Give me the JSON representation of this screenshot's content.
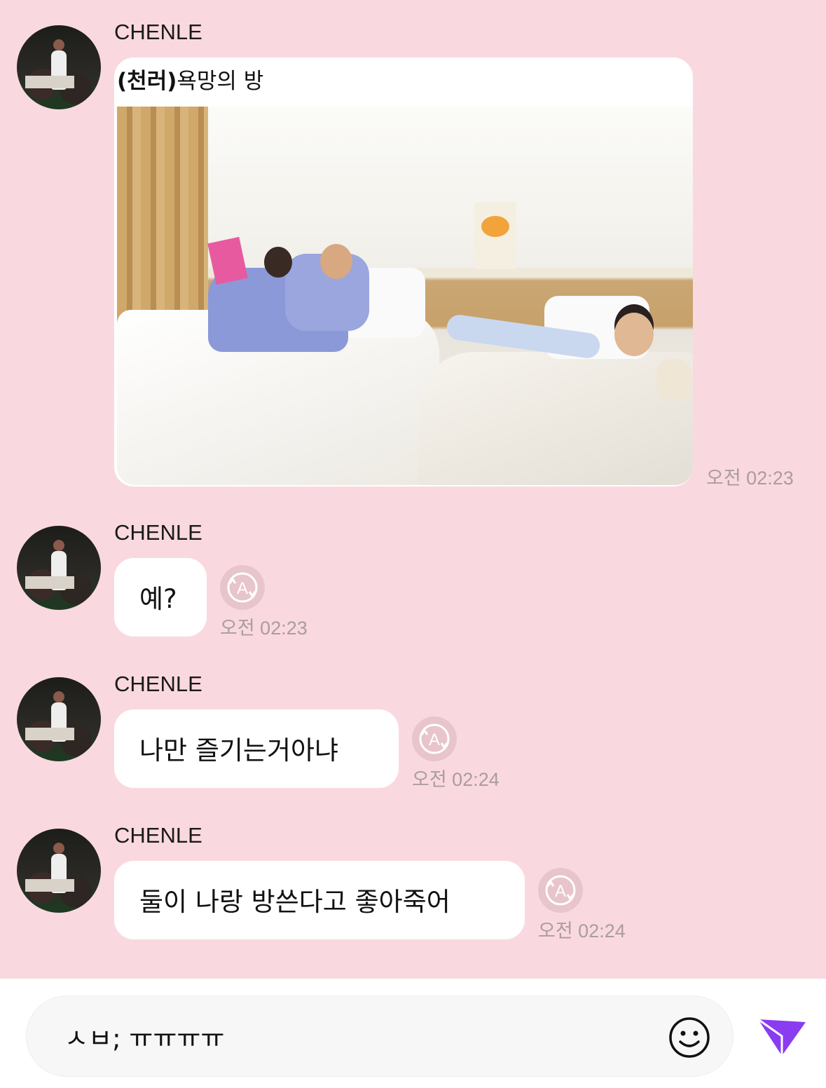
{
  "messages": [
    {
      "sender": "CHENLE",
      "type": "image",
      "caption_bold": "(천러)",
      "caption_rest": "욕망의 방",
      "time": "오전 02:23"
    },
    {
      "sender": "CHENLE",
      "type": "text",
      "text": "예?",
      "time": "오전 02:23"
    },
    {
      "sender": "CHENLE",
      "type": "text",
      "text": "나만 즐기는거아냐",
      "time": "오전 02:24"
    },
    {
      "sender": "CHENLE",
      "type": "text",
      "text": "둘이 나랑 방쓴다고 좋아죽어",
      "time": "오전 02:24"
    }
  ],
  "input": {
    "value": "ㅅㅂ; ㅠㅠㅠㅠ"
  },
  "icons": {
    "translate": "translate-icon",
    "emoji": "smiley-icon",
    "send": "paper-plane-icon"
  },
  "colors": {
    "background": "#f9d9df",
    "bubble": "#ffffff",
    "send_accent": "#8a3cf0",
    "timestamp": "#aa9ca0"
  }
}
